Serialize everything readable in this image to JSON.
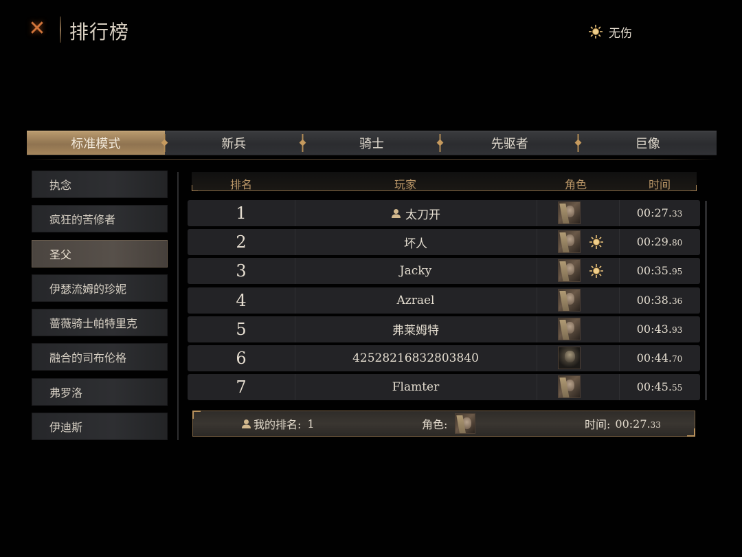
{
  "header": {
    "close_icon": "close-x-icon",
    "title": "排行榜",
    "flawless_label": "无伤",
    "flawless_icon": "sun-icon"
  },
  "tabs": [
    {
      "label": "标准模式",
      "active": true
    },
    {
      "label": "新兵",
      "active": false
    },
    {
      "label": "骑士",
      "active": false
    },
    {
      "label": "先驱者",
      "active": false
    },
    {
      "label": "巨像",
      "active": false
    }
  ],
  "bosses": [
    {
      "label": "执念",
      "selected": false
    },
    {
      "label": "疯狂的苦修者",
      "selected": false
    },
    {
      "label": "圣父",
      "selected": true
    },
    {
      "label": "伊瑟流姆的珍妮",
      "selected": false
    },
    {
      "label": "蔷薇骑士帕特里克",
      "selected": false
    },
    {
      "label": "融合的司布伦格",
      "selected": false
    },
    {
      "label": "弗罗洛",
      "selected": false
    },
    {
      "label": "伊迪斯",
      "selected": false
    }
  ],
  "table": {
    "columns": {
      "rank": "排名",
      "player": "玩家",
      "character": "角色",
      "time": "时间"
    },
    "rows": [
      {
        "rank": "1",
        "player": "太刀开",
        "self": true,
        "portrait": "blonde-portrait",
        "flawless": false,
        "time_main": "00:27.",
        "time_frac": "33"
      },
      {
        "rank": "2",
        "player": "坏人",
        "self": false,
        "portrait": "blonde-portrait",
        "flawless": true,
        "time_main": "00:29.",
        "time_frac": "80"
      },
      {
        "rank": "3",
        "player": "Jacky",
        "self": false,
        "portrait": "blonde-portrait",
        "flawless": true,
        "time_main": "00:35.",
        "time_frac": "95"
      },
      {
        "rank": "4",
        "player": "Azrael",
        "self": false,
        "portrait": "blonde-portrait",
        "flawless": false,
        "time_main": "00:38.",
        "time_frac": "36"
      },
      {
        "rank": "5",
        "player": "弗莱姆特",
        "self": false,
        "portrait": "blonde-portrait",
        "flawless": false,
        "time_main": "00:43.",
        "time_frac": "93"
      },
      {
        "rank": "6",
        "player": "42528216832803840",
        "self": false,
        "portrait": "skull-portrait",
        "flawless": false,
        "time_main": "00:44.",
        "time_frac": "70"
      },
      {
        "rank": "7",
        "player": "Flamter",
        "self": false,
        "portrait": "blonde-portrait",
        "flawless": false,
        "time_main": "00:45.",
        "time_frac": "55"
      }
    ]
  },
  "my_rank": {
    "rank_label": "我的排名:",
    "rank_value": "1",
    "character_label": "角色:",
    "time_label": "时间:",
    "time_main": "00:27.",
    "time_frac": "33"
  },
  "colors": {
    "accent_gold": "#b8915c",
    "active_tab": "#a6865c",
    "close_orange": "#d0743a"
  }
}
